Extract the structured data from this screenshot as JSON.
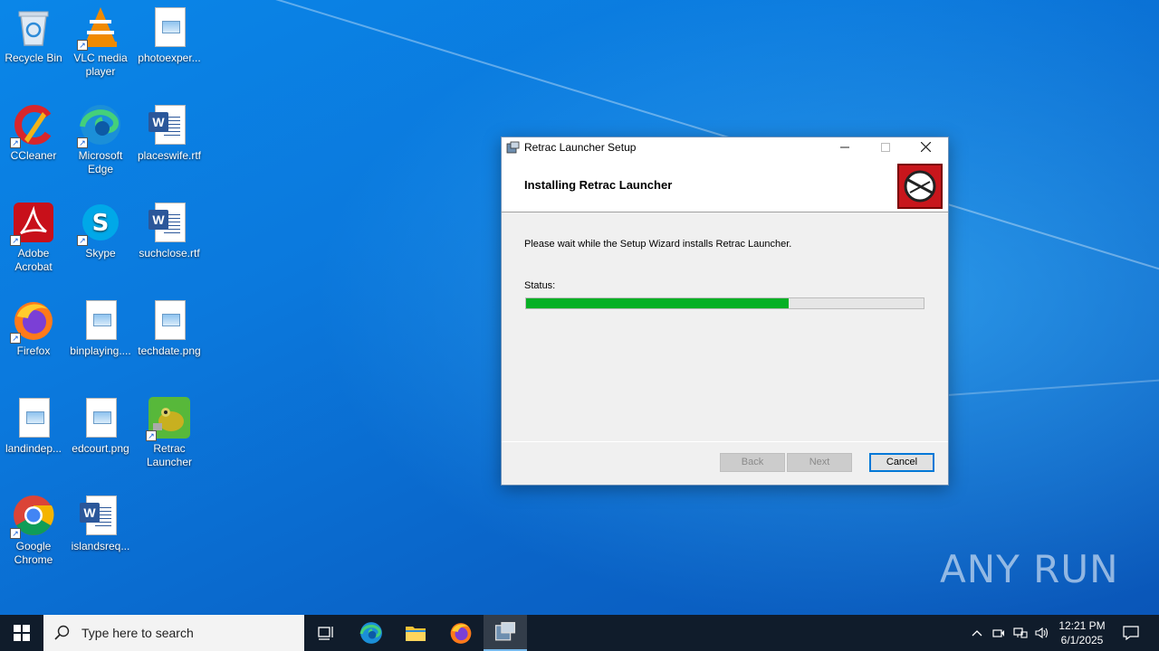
{
  "desktop": {
    "icons": [
      {
        "label": "Recycle Bin",
        "icon": "recycle-bin-icon"
      },
      {
        "label": "VLC media player",
        "icon": "vlc-icon"
      },
      {
        "label": "photoexper...",
        "icon": "image-file-icon"
      },
      {
        "label": "CCleaner",
        "icon": "ccleaner-icon"
      },
      {
        "label": "Microsoft Edge",
        "icon": "edge-icon"
      },
      {
        "label": "placeswife.rtf",
        "icon": "word-doc-icon"
      },
      {
        "label": "Adobe Acrobat",
        "icon": "acrobat-icon"
      },
      {
        "label": "Skype",
        "icon": "skype-icon"
      },
      {
        "label": "suchclose.rtf",
        "icon": "word-doc-icon"
      },
      {
        "label": "Firefox",
        "icon": "firefox-icon"
      },
      {
        "label": "binplaying....",
        "icon": "image-file-icon"
      },
      {
        "label": "techdate.png",
        "icon": "image-file-icon"
      },
      {
        "label": "landindep...",
        "icon": "image-file-icon"
      },
      {
        "label": "edcourt.png",
        "icon": "image-file-icon"
      },
      {
        "label": "Retrac Launcher",
        "icon": "retrac-launcher-icon"
      },
      {
        "label": "Google Chrome",
        "icon": "chrome-icon"
      },
      {
        "label": "islandsreq...",
        "icon": "word-doc-icon"
      }
    ]
  },
  "dialog": {
    "title": "Retrac Launcher Setup",
    "header_title": "Installing Retrac Launcher",
    "message": "Please wait while the Setup Wizard installs Retrac Launcher.",
    "status_label": "Status:",
    "progress_percent": 66,
    "buttons": {
      "back": "Back",
      "next": "Next",
      "cancel": "Cancel"
    }
  },
  "watermark": "ANY RUN",
  "taskbar": {
    "search_placeholder": "Type here to search",
    "time": "12:21 PM",
    "date": "6/1/2025"
  },
  "colors": {
    "progress_fill": "#06b025",
    "accent": "#0078d7"
  }
}
